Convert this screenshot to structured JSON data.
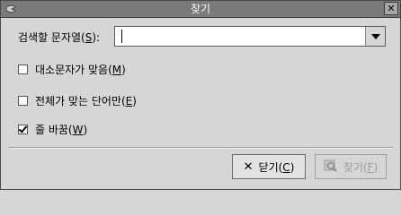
{
  "window": {
    "title": "찾기",
    "close_glyph": "✕"
  },
  "search": {
    "label_prefix": "검색할 문자열(",
    "label_mnemonic": "S",
    "label_suffix": "):",
    "value": ""
  },
  "options": [
    {
      "prefix": "대소문자가 맞음(",
      "mnemonic": "M",
      "suffix": ")",
      "checked": false
    },
    {
      "prefix": "전체가 맞는 단어만(",
      "mnemonic": "E",
      "suffix": ")",
      "checked": false
    },
    {
      "prefix": "줄 바꿈(",
      "mnemonic": "W",
      "suffix": ")",
      "checked": true
    }
  ],
  "buttons": {
    "close": {
      "glyph": "✕",
      "prefix": "닫기(",
      "mnemonic": "C",
      "suffix": ")"
    },
    "find": {
      "prefix": "찾기(",
      "mnemonic": "F",
      "suffix": ")",
      "enabled": false
    }
  }
}
